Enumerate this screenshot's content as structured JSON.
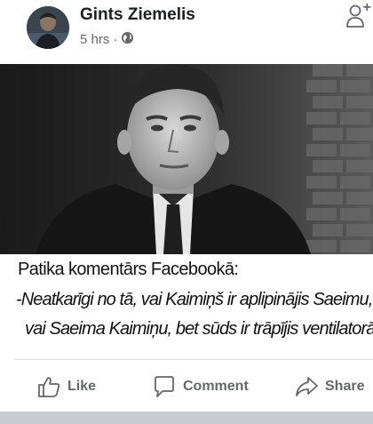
{
  "post": {
    "author": "Gints Ziemelis",
    "time": "5 hrs",
    "separator": "·",
    "privacy_icon": "globe-icon",
    "add_friend_icon": "add-friend-icon",
    "add_friend_plus": "+"
  },
  "caption": {
    "line1": "Patika komentārs Facebookā:",
    "line2": "-Neatkarīgi no tā, vai Kaimiņš ir aplipinājis Saeimu,",
    "line3": "vai Saeima Kaimiņu, bet sūds ir trāpījis ventilatorā."
  },
  "actions": {
    "like": "Like",
    "comment": "Comment",
    "share": "Share"
  },
  "colors": {
    "text_primary": "#1c1e21",
    "text_secondary": "#65676b",
    "divider": "#dadde1",
    "band": "#c9ccd1"
  }
}
